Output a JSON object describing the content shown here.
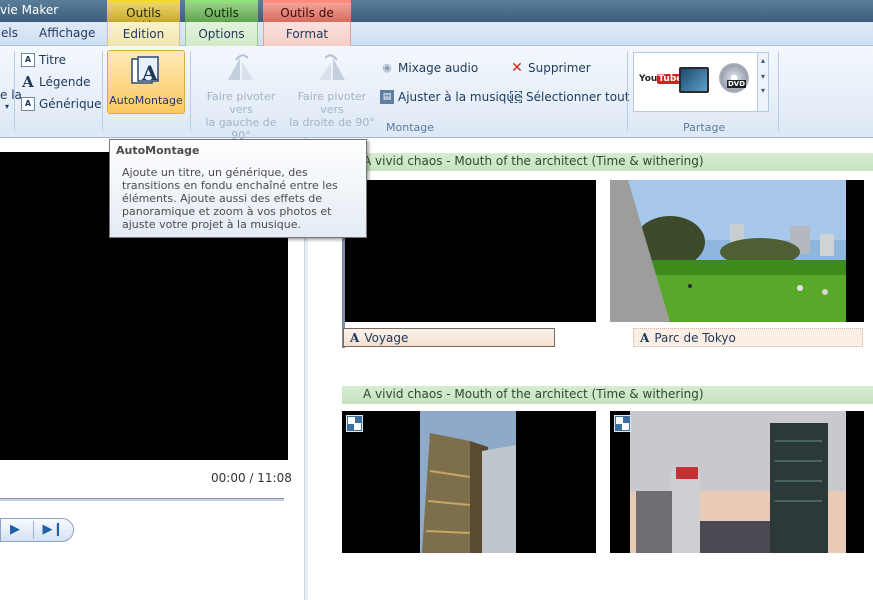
{
  "window": {
    "title": "vie Maker"
  },
  "contextual_groups": {
    "video_tools": "Outils vidéo",
    "audio_tools": "Outils audio",
    "text_tools": "Outils de texte"
  },
  "tabs": {
    "partial_left": "els",
    "affichage": "Affichage",
    "edition": "Edition",
    "options": "Options",
    "format": "Format"
  },
  "ribbon": {
    "partial_cut": "e la",
    "add": {
      "titre": "Titre",
      "legende": "Légende",
      "generique": "Générique"
    },
    "automontage": "AutoMontage",
    "rotate_left": [
      "Faire pivoter vers",
      "la gauche de 90°"
    ],
    "rotate_right": [
      "Faire pivoter vers",
      "la droite de 90°"
    ],
    "mixage_audio": "Mixage audio",
    "ajuster_musique": "Ajuster à la musique",
    "supprimer": "Supprimer",
    "selectionner_tout": "Sélectionner tout",
    "group_montage": "Montage",
    "group_partage": "Partage",
    "share_icons": [
      "youtube-icon",
      "monitor-icon",
      "dvd-icon"
    ]
  },
  "tooltip": {
    "title": "AutoMontage",
    "body": "Ajoute un titre, un générique, des transitions en fondu enchaîné entre les éléments. Ajoute aussi des effets de panoramique et zoom à vos photos et ajuste votre projet à la musique."
  },
  "player": {
    "time": "00:00 / 11:08"
  },
  "storyboard": {
    "music_1": "A vivid chaos - Mouth of the architect (Time & withering)",
    "music_2": "A vivid chaos - Mouth of the architect (Time & withering)",
    "caption_1": "Voyage",
    "caption_2": "Parc de Tokyo"
  },
  "colors": {
    "highlight": "#fbc95e",
    "music_track": "#c6e2c0",
    "caption_bg": "#f3dfd0"
  }
}
